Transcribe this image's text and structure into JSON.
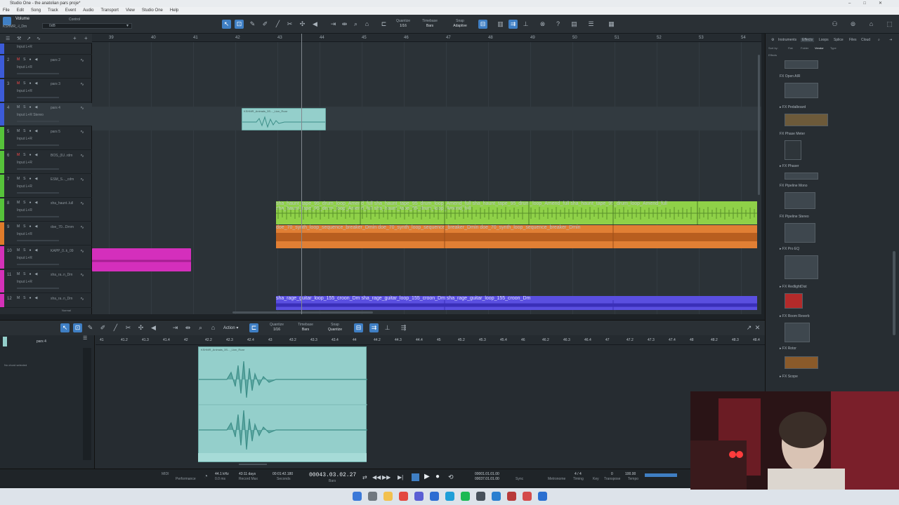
{
  "window": {
    "title": "Studio One - the anatolian pars proje*"
  },
  "menu": [
    "File",
    "Edit",
    "Song",
    "Track",
    "Event",
    "Audio",
    "Transport",
    "View",
    "Studio One",
    "Help"
  ],
  "toolbar": {
    "selected_track": "Volume",
    "selected_track_sub": "KSHMR_-l_Dm",
    "control_label": "Control",
    "value": "0dB",
    "quantize_label": "Quantize",
    "quantize_value": "1/16",
    "timebase_label": "Timebase",
    "timebase_value": "Bars",
    "snap_label": "Snap",
    "snap_value": "Adaptive"
  },
  "ruler": [
    "39",
    "40",
    "41",
    "42",
    "43",
    "44",
    "45",
    "46",
    "47",
    "48",
    "49",
    "50",
    "51",
    "52",
    "53",
    "54"
  ],
  "tracks": [
    {
      "num": "1",
      "name": "",
      "input": "Input L+R",
      "color": "#3c5bd8",
      "muted": false
    },
    {
      "num": "2",
      "name": "pars 2",
      "input": "Input L+R",
      "color": "#3c5bd8",
      "muted": true
    },
    {
      "num": "3",
      "name": "pars 3",
      "input": "Input L+R",
      "color": "#3c5bd8",
      "muted": true
    },
    {
      "num": "4",
      "name": "pars 4",
      "input": "Input L+R Stereo",
      "color": "#3c5bd8",
      "muted": false
    },
    {
      "num": "5",
      "name": "pars 5",
      "input": "Input L+R",
      "color": "#56c23a",
      "muted": false
    },
    {
      "num": "6",
      "name": "BOS_(IU..rdm",
      "input": "Input L+R",
      "color": "#56c23a",
      "muted": true
    },
    {
      "num": "7",
      "name": "ESM_S..._cdm",
      "input": "Input L+R",
      "color": "#56c23a",
      "muted": false
    },
    {
      "num": "8",
      "name": "sha_haunt..lull",
      "input": "Input L+R",
      "color": "#56c23a",
      "muted": false
    },
    {
      "num": "9",
      "name": "doe_70...Drnm",
      "input": "Input L+R",
      "color": "#e07b2a",
      "muted": false
    },
    {
      "num": "10",
      "name": "KAPP_0..k_09",
      "input": "Input L+R",
      "color": "#d431b8",
      "muted": false
    },
    {
      "num": "11",
      "name": "sha_ra..n_Dm",
      "input": "Input L+R",
      "color": "#d431b8",
      "muted": false
    },
    {
      "num": "12",
      "name": "sha_ra..n_Dm",
      "input": "Input L+R",
      "color": "#d431b8",
      "muted": false
    }
  ],
  "clips": {
    "pars4": "KSHMR_Animals_3S..._Lion_Roar",
    "drum": "sha_haunt_tape_95_drum_loop_Amend_full",
    "synth": "doe_70_synth_loop_sequence_breaker_Dmin",
    "guitar": "sha_rage_guitar_loop_155_croon_Dm"
  },
  "right_panel": {
    "tabs": [
      "Instruments",
      "Effects",
      "Loops",
      "Splice",
      "Files",
      "Cloud"
    ],
    "sort_label": "Sort by:",
    "sort_options": [
      "Flat",
      "Folder",
      "Vendor",
      "Type"
    ],
    "breadcrumb": "Effects",
    "effects": [
      "Open AIR",
      "Pedalboard",
      "Phase Meter",
      "Phaser",
      "Pipeline Mono",
      "Pipeline Stereo",
      "Pro EQ",
      "RedlightDist",
      "Room Reverb",
      "Rotor",
      "Scope"
    ]
  },
  "editor": {
    "track_name": "pars 4",
    "no_chord": "No chord selected",
    "action_label": "Action",
    "quantize_label": "Quantize",
    "quantize_value": "1/16",
    "timebase_label": "Timebase",
    "timebase_value": "Bars",
    "snap_label": "Snap",
    "snap_value": "Quantize",
    "clip_title": "KSHMR_Animals_3S..._Lion_Roar",
    "ruler": [
      "41",
      "41.2",
      "41.3",
      "41.4",
      "42",
      "42.2",
      "42.3",
      "42.4",
      "43",
      "43.2",
      "43.3",
      "43.4",
      "44",
      "44.2",
      "44.3",
      "44.4",
      "45",
      "45.2",
      "45.3",
      "45.4",
      "46",
      "46.2",
      "46.3",
      "46.4",
      "47",
      "47.2",
      "47.3",
      "47.4",
      "48",
      "48.2",
      "48.3",
      "48.4"
    ],
    "zoom_label": "Normal"
  },
  "transport": {
    "midi": "MIDI",
    "performance": "Performance",
    "sample_rate": "44.1 kHz",
    "latency": "0.0 ms",
    "record_max": "43:11 days",
    "record_label": "Record Max",
    "seconds_value": "00:01:42.180",
    "seconds_label": "Seconds",
    "position": "00043.03.02.27",
    "position_label": "Bars",
    "loop_start": "00001.01.01.00",
    "loop_end": "00037.01.01.00",
    "sync_label": "Sync",
    "metronome_label": "Metronome",
    "timing_label": "Timing",
    "time_sig": "4 / 4",
    "key_label": "Key",
    "transpose": "0",
    "transpose_label": "Transpose",
    "tempo": "100.00",
    "tempo_label": "Tempo"
  },
  "colors": {
    "drum_clip": "#8fd148",
    "synth_clip": "#e17f34",
    "guitar_clip": "#5a4fe0",
    "pars_clip": "#94cfcb",
    "pink_clip": "#d42fbc"
  }
}
